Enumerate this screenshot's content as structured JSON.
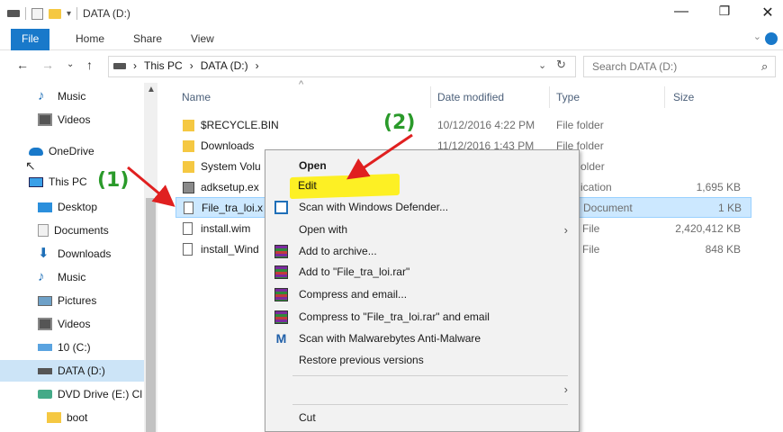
{
  "title": {
    "window_title": "DATA (D:)",
    "minimize": "—",
    "maximize": "❐",
    "close": "✕"
  },
  "ribbon": {
    "tabs": [
      "File",
      "Home",
      "Share",
      "View"
    ]
  },
  "address": {
    "crumbs": [
      "This PC",
      "DATA (D:)"
    ],
    "separator": "›",
    "search_placeholder": "Search DATA (D:)"
  },
  "nav": {
    "items": [
      {
        "label": "Music",
        "icon": "music-icon"
      },
      {
        "label": "Videos",
        "icon": "video-icon"
      },
      {
        "label": "OneDrive",
        "icon": "onedrive-icon"
      },
      {
        "label": "This PC",
        "icon": "computer-icon"
      },
      {
        "label": "Desktop",
        "icon": "desktop-icon"
      },
      {
        "label": "Documents",
        "icon": "documents-icon"
      },
      {
        "label": "Downloads",
        "icon": "downloads-icon"
      },
      {
        "label": "Music",
        "icon": "music-icon"
      },
      {
        "label": "Pictures",
        "icon": "pictures-icon"
      },
      {
        "label": "Videos",
        "icon": "video-icon"
      },
      {
        "label": "10 (C:)",
        "icon": "drive-c-icon"
      },
      {
        "label": "DATA (D:)",
        "icon": "drive-d-icon"
      },
      {
        "label": "DVD Drive (E:) Cl",
        "icon": "dvd-icon"
      },
      {
        "label": "boot",
        "icon": "folder-icon"
      }
    ]
  },
  "columns": {
    "name": "Name",
    "date": "Date modified",
    "type": "Type",
    "size": "Size"
  },
  "files": [
    {
      "name": "$RECYCLE.BIN",
      "date": "10/12/2016 4:22 PM",
      "type": "File folder",
      "size": ""
    },
    {
      "name": "Downloads",
      "date": "11/12/2016 1:43 PM",
      "type": "File folder",
      "size": ""
    },
    {
      "name": "System Volu",
      "date": "",
      "type": "older",
      "size": ""
    },
    {
      "name": "adksetup.ex",
      "date": "",
      "type": "ication",
      "size": "1,695 KB"
    },
    {
      "name": "File_tra_loi.x",
      "date": "",
      "type": "Document",
      "size": "1 KB"
    },
    {
      "name": "install.wim",
      "date": "",
      "type": "File",
      "size": "2,420,412 KB"
    },
    {
      "name": "install_Wind",
      "date": "",
      "type": "File",
      "size": "848 KB"
    }
  ],
  "context_menu": {
    "items": [
      {
        "label": "Open",
        "icon": "",
        "submenu": false,
        "bold": true
      },
      {
        "label": "Edit",
        "icon": "",
        "submenu": false,
        "bold": false
      },
      {
        "label": "Scan with Windows Defender...",
        "icon": "defender-icon",
        "submenu": false,
        "bold": false
      },
      {
        "label": "Open with",
        "icon": "",
        "submenu": true,
        "bold": false
      },
      {
        "label": "Add to archive...",
        "icon": "winrar-icon",
        "submenu": false,
        "bold": false
      },
      {
        "label": "Add to \"File_tra_loi.rar\"",
        "icon": "winrar-icon",
        "submenu": false,
        "bold": false
      },
      {
        "label": "Compress and email...",
        "icon": "winrar-icon",
        "submenu": false,
        "bold": false
      },
      {
        "label": "Compress to \"File_tra_loi.rar\" and email",
        "icon": "winrar-icon",
        "submenu": false,
        "bold": false
      },
      {
        "label": "Scan with Malwarebytes Anti-Malware",
        "icon": "malwarebytes-icon",
        "submenu": false,
        "bold": false
      },
      {
        "label": "Restore previous versions",
        "icon": "",
        "submenu": false,
        "bold": false
      },
      {
        "label": "",
        "icon": "",
        "submenu": true,
        "bold": false
      },
      {
        "label": "Cut",
        "icon": "",
        "submenu": false,
        "bold": false
      }
    ],
    "submenu_arrow": "›"
  },
  "annotations": {
    "step1": "(1)",
    "step2": "(2)",
    "arrow_color": "#e02020",
    "highlight_color": "#fff000"
  }
}
